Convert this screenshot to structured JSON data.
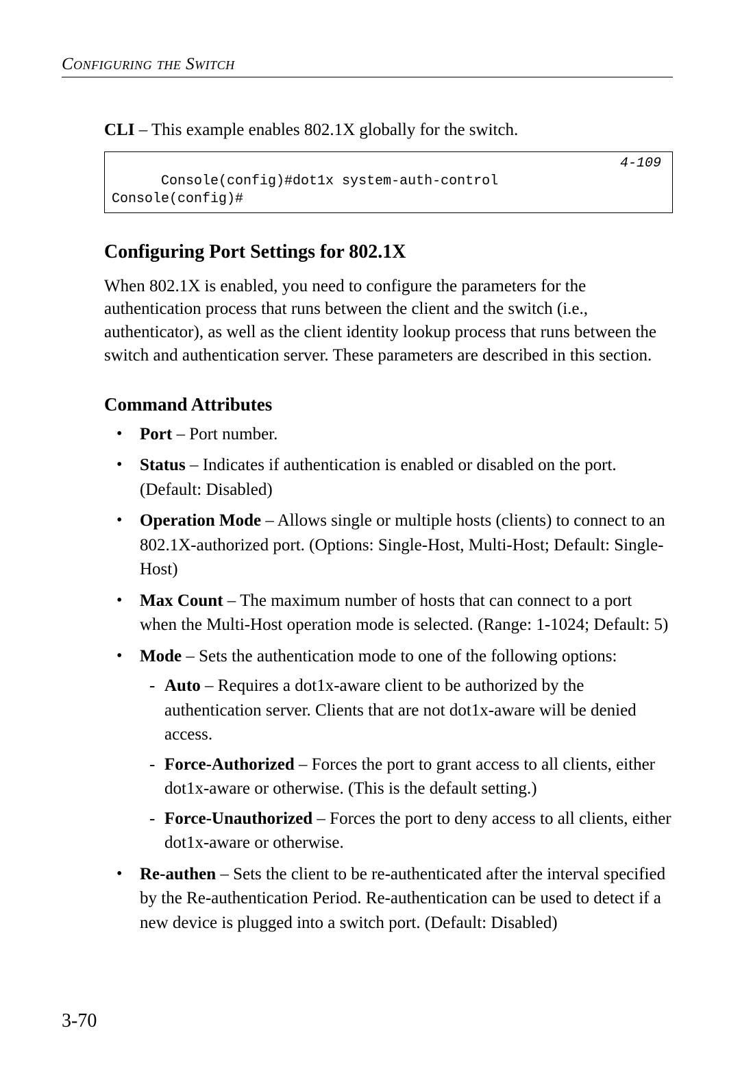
{
  "running_head": "Configuring the Switch",
  "intro_bold": "CLI",
  "intro_text": " – This example enables 802.1X globally for the switch.",
  "code": {
    "line1": "Console(config)#dot1x system-auth-control",
    "line2": "Console(config)#",
    "ref": "4-109"
  },
  "section_heading": "Configuring Port Settings for 802.1X",
  "section_para": "When 802.1X is enabled, you need to configure the parameters for the authentication process that runs between the client and the switch (i.e., authenticator), as well as the client identity lookup process that runs between the switch and authentication server. These parameters are described in this section.",
  "subsection_heading": "Command Attributes",
  "bullets": {
    "port_term": "Port",
    "port_desc": " – Port number.",
    "status_term": "Status",
    "status_desc": " – Indicates if authentication is enabled or disabled on the port. (Default: Disabled)",
    "opmode_term": "Operation Mode",
    "opmode_desc": " – Allows single or multiple hosts (clients) to connect to an 802.1X-authorized port. (Options: Single-Host, Multi-Host; Default: Single-Host)",
    "maxcount_term": "Max Count",
    "maxcount_desc": " – The maximum number of hosts that can connect to a port when the Multi-Host operation mode is selected. (Range: 1-1024; Default: 5)",
    "mode_term": "Mode",
    "mode_desc": " – Sets the authentication mode to one of the following options:",
    "sub": {
      "auto_term": "Auto",
      "auto_desc": " – Requires a dot1x-aware client to be authorized by the authentication server. Clients that are not dot1x-aware will be denied access.",
      "fa_term": "Force-Authorized",
      "fa_desc": " – Forces the port to grant access to all clients, either dot1x-aware or otherwise. (This is the default setting.)",
      "fu_term": "Force-Unauthorized",
      "fu_desc": " – Forces the port to deny access to all clients, either dot1x-aware or otherwise."
    },
    "reauth_term": "Re-authen",
    "reauth_desc": " – Sets the client to be re-authenticated after the interval specified by the Re-authentication Period. Re-authentication can be used to detect if a new device is plugged into a switch port. (Default: Disabled)"
  },
  "page_number": "3-70"
}
